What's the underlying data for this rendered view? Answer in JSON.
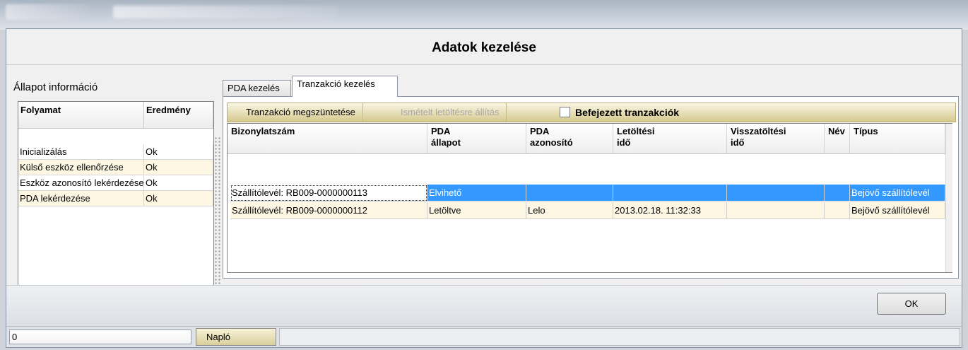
{
  "dialog": {
    "title": "Adatok kezelése"
  },
  "left_panel": {
    "label": "Állapot információ",
    "columns": [
      "Folyamat",
      "Eredmény"
    ],
    "rows": [
      [
        "Inicializálás",
        "Ok"
      ],
      [
        "Külső eszköz ellenőrzése",
        "Ok"
      ],
      [
        "Eszköz azonosító lekérdezése",
        "Ok"
      ],
      [
        "PDA lekérdezése",
        "Ok"
      ]
    ]
  },
  "tabs": [
    {
      "label": "PDA kezelés",
      "active": false
    },
    {
      "label": "Tranzakció kezelés",
      "active": true
    }
  ],
  "toolbar": {
    "cancel_label": "Tranzakció megszüntetése",
    "redownload_label": "Ismételt letöltésre állítás",
    "finished_checkbox_label": "Befejezett tranzakciók",
    "finished_checked": false
  },
  "grid": {
    "columns": [
      "Bizonylatszám",
      "PDA\nállapot",
      "PDA\nazonosító",
      "Letöltési\nidő",
      "Visszatöltési\nidő",
      "Név",
      "Típus"
    ],
    "rows": [
      [
        "Szállítólevél: RB009-0000000113",
        "Elvihető",
        "",
        "",
        "",
        "",
        "Bejövő szállítólevél"
      ],
      [
        "Szállítólevél: RB009-0000000112",
        "Letöltve",
        "Lelo",
        "2013.02.18. 11:32:33",
        "",
        "",
        "Bejövő szállítólevél"
      ]
    ],
    "selected_row": 0
  },
  "ok_label": "OK",
  "statusbar": {
    "progress_value": "0",
    "naplo_label": "Napló"
  },
  "colors": {
    "selection": "#3399ff",
    "toolbar_gold": "#d6c98e",
    "alt_row": "#fdf6e3"
  }
}
